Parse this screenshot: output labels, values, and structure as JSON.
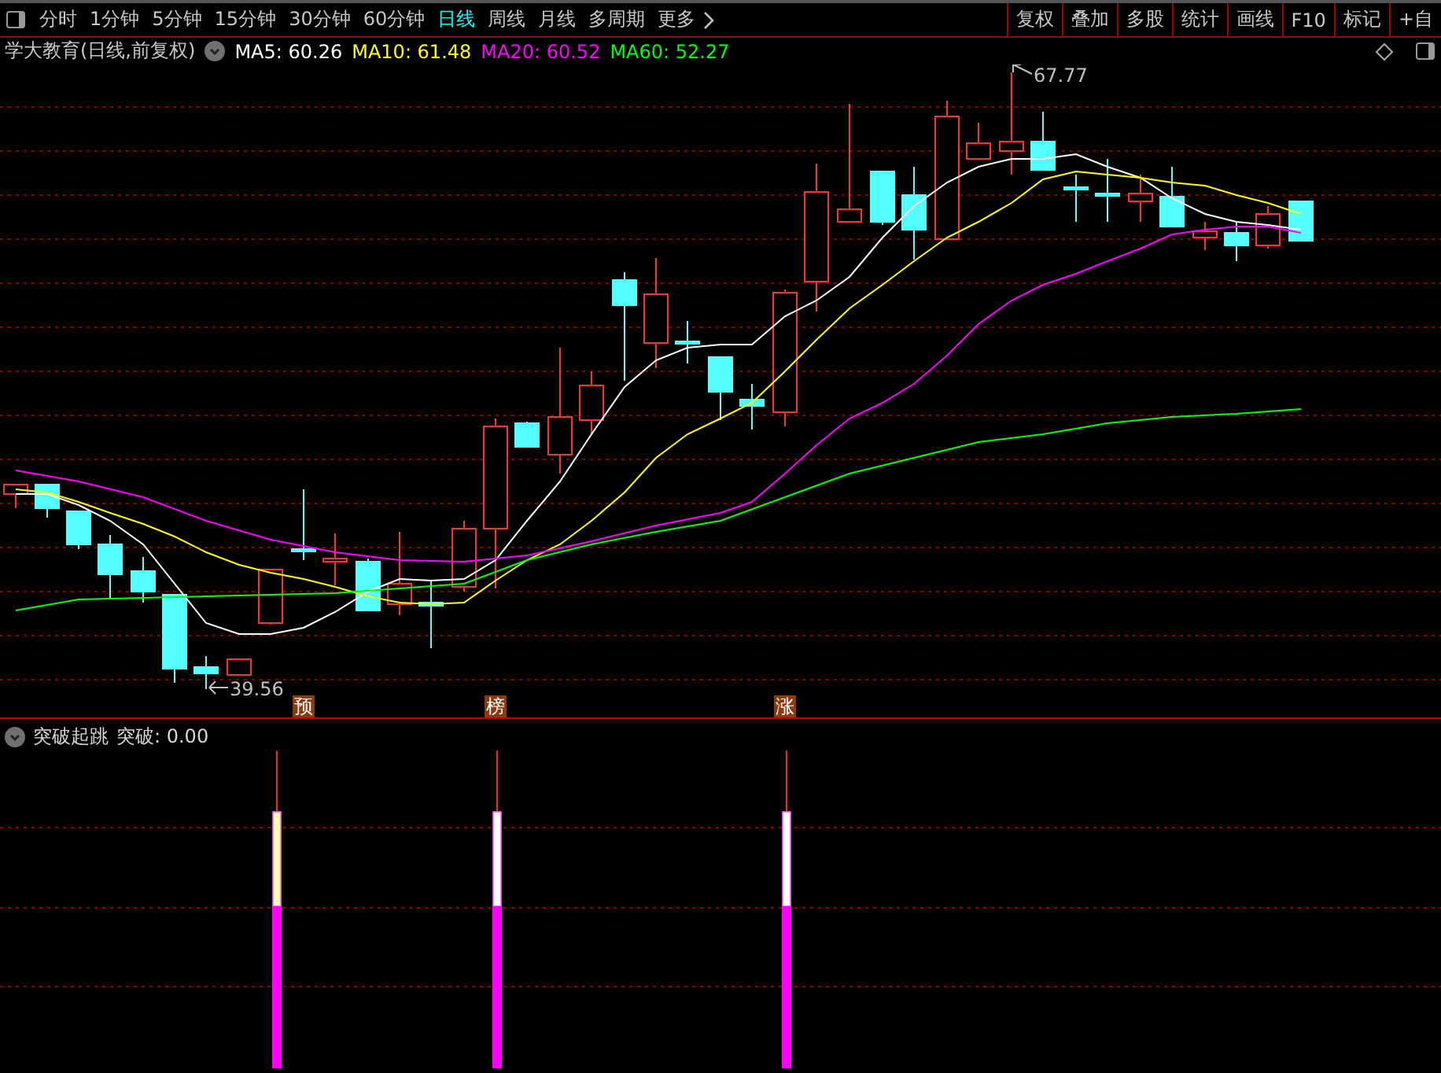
{
  "toolbar": {
    "periods": [
      {
        "label": "分时",
        "selected": false
      },
      {
        "label": "1分钟",
        "selected": false
      },
      {
        "label": "5分钟",
        "selected": false
      },
      {
        "label": "15分钟",
        "selected": false
      },
      {
        "label": "30分钟",
        "selected": false
      },
      {
        "label": "60分钟",
        "selected": false
      },
      {
        "label": "日线",
        "selected": true
      },
      {
        "label": "周线",
        "selected": false
      },
      {
        "label": "月线",
        "selected": false
      },
      {
        "label": "多周期",
        "selected": false
      },
      {
        "label": "更多",
        "selected": false
      }
    ],
    "buttons": [
      "复权",
      "叠加",
      "多股",
      "统计",
      "画线",
      "F10",
      "标记",
      "+自"
    ]
  },
  "main_chart": {
    "title": "学大教育(日线,前复权)",
    "indicators": [
      {
        "name": "MA5:",
        "value": "60.26",
        "color": "#ffffff"
      },
      {
        "name": "MA10:",
        "value": "61.48",
        "color": "#ffff00"
      },
      {
        "name": "MA20:",
        "value": "60.52",
        "color": "#ff00ff"
      },
      {
        "name": "MA60:",
        "value": "52.27",
        "color": "#00ff00"
      }
    ],
    "high_label": "67.77",
    "low_label": "39.56",
    "signals": [
      "预",
      "榜",
      "涨"
    ]
  },
  "sub_chart": {
    "title": "突破起跳",
    "reading": "突破: 0.00"
  }
}
